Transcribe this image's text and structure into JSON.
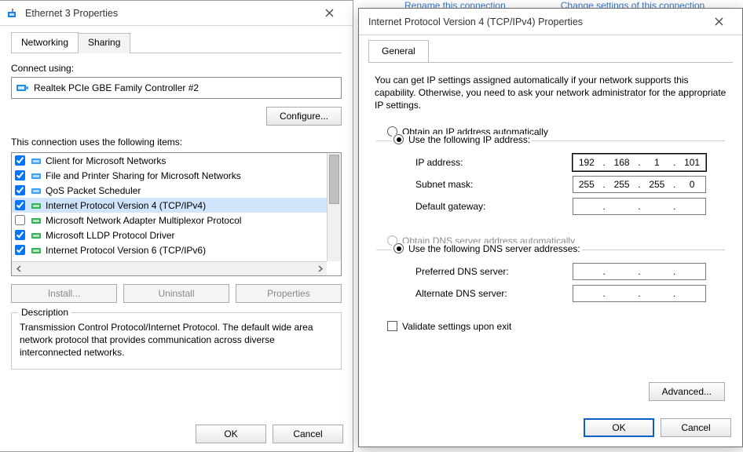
{
  "bg_menu": {
    "rename": "Rename this connection",
    "change": "Change settings of this connection"
  },
  "eth": {
    "title": "Ethernet 3 Properties",
    "tabs": {
      "networking": "Networking",
      "sharing": "Sharing"
    },
    "connect_using_label": "Connect using:",
    "adapter": "Realtek PCIe GBE Family Controller #2",
    "configure_btn": "Configure...",
    "items_label": "This connection uses the following items:",
    "items": [
      {
        "checked": true,
        "iconColor": "#3aa0ff",
        "label": "Client for Microsoft Networks"
      },
      {
        "checked": true,
        "iconColor": "#3aa0ff",
        "label": "File and Printer Sharing for Microsoft Networks"
      },
      {
        "checked": true,
        "iconColor": "#3aa0ff",
        "label": "QoS Packet Scheduler"
      },
      {
        "checked": true,
        "iconColor": "#34b255",
        "label": "Internet Protocol Version 4 (TCP/IPv4)",
        "selected": true
      },
      {
        "checked": false,
        "iconColor": "#34b255",
        "label": "Microsoft Network Adapter Multiplexor Protocol"
      },
      {
        "checked": true,
        "iconColor": "#34b255",
        "label": "Microsoft LLDP Protocol Driver"
      },
      {
        "checked": true,
        "iconColor": "#34b255",
        "label": "Internet Protocol Version 6 (TCP/IPv6)"
      }
    ],
    "install_btn": "Install...",
    "uninstall_btn": "Uninstall",
    "properties_btn": "Properties",
    "description_legend": "Description",
    "description_text": "Transmission Control Protocol/Internet Protocol. The default wide area network protocol that provides communication across diverse interconnected networks.",
    "ok_btn": "OK",
    "cancel_btn": "Cancel"
  },
  "ip": {
    "title": "Internet Protocol Version 4 (TCP/IPv4) Properties",
    "tab_general": "General",
    "explain": "You can get IP settings assigned automatically if your network supports this capability. Otherwise, you need to ask your network administrator for the appropriate IP settings.",
    "r_obtain_ip": "Obtain an IP address automatically",
    "r_use_ip": "Use the following IP address:",
    "lbl_ip": "IP address:",
    "lbl_mask": "Subnet mask:",
    "lbl_gw": "Default gateway:",
    "ip_value": {
      "o1": "192",
      "o2": "168",
      "o3": "1",
      "o4": "101"
    },
    "mask_value": {
      "o1": "255",
      "o2": "255",
      "o3": "255",
      "o4": "0"
    },
    "gw_value": {
      "o1": "",
      "o2": "",
      "o3": "",
      "o4": ""
    },
    "r_obtain_dns": "Obtain DNS server address automatically",
    "r_use_dns": "Use the following DNS server addresses:",
    "lbl_pref_dns": "Preferred DNS server:",
    "lbl_alt_dns": "Alternate DNS server:",
    "pref_dns": {
      "o1": "",
      "o2": "",
      "o3": "",
      "o4": ""
    },
    "alt_dns": {
      "o1": "",
      "o2": "",
      "o3": "",
      "o4": ""
    },
    "validate_label": "Validate settings upon exit",
    "advanced_btn": "Advanced...",
    "ok_btn": "OK",
    "cancel_btn": "Cancel"
  }
}
